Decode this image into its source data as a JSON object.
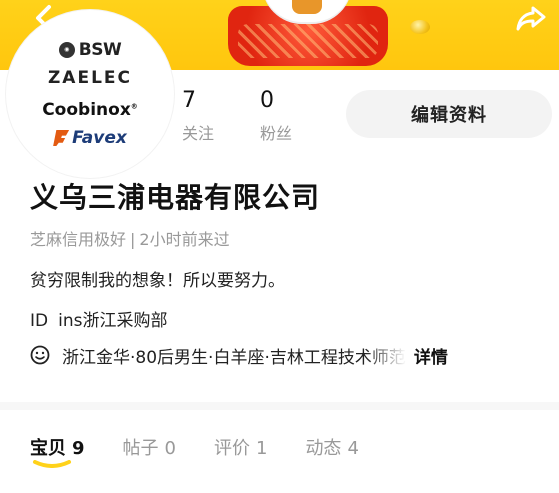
{
  "header": {
    "back_icon": "chevron-left-icon",
    "share_icon": "share-arrow-icon"
  },
  "avatar": {
    "logos": {
      "bsw": "BSW",
      "zaelec": "ZAELEC",
      "coobinox": "Coobinox",
      "favex": "Favex"
    }
  },
  "stats": {
    "follow": {
      "value": "7",
      "label": "关注"
    },
    "fans": {
      "value": "0",
      "label": "粉丝"
    }
  },
  "edit_button": {
    "label": "编辑资料"
  },
  "profile": {
    "name": "义乌三浦电器有限公司",
    "credit": "芝麻信用极好",
    "separator": "|",
    "last_seen": "2小时前来过",
    "bio": "贫穷限制我的想象！所以要努力。",
    "id_label": "ID",
    "id_value": "ins浙江采购部",
    "info": "浙江金华·80后男生·白羊座·吉林工程技术师范",
    "detail_link": "详情"
  },
  "tabs": [
    {
      "label": "宝贝",
      "count": "9",
      "active": true
    },
    {
      "label": "帖子",
      "count": "0",
      "active": false
    },
    {
      "label": "评价",
      "count": "1",
      "active": false
    },
    {
      "label": "动态",
      "count": "4",
      "active": false
    }
  ],
  "colors": {
    "banner": "#ffcb12",
    "accent_underline": "#ffd21a",
    "muted_text": "#999999",
    "button_bg": "#f3f3f3"
  }
}
